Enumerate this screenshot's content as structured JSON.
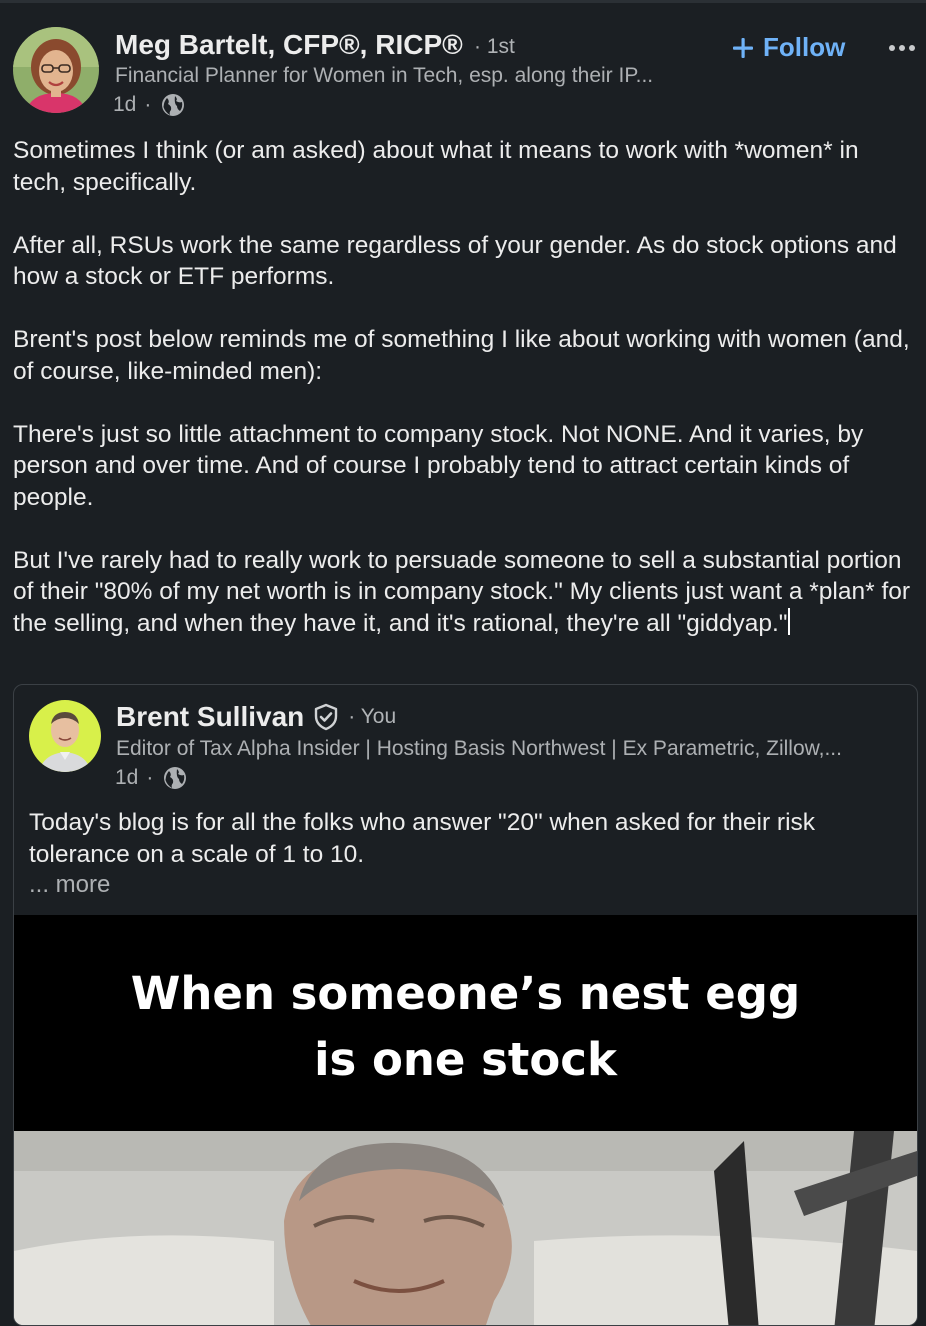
{
  "post": {
    "author": {
      "name": "Meg Bartelt, CFP®, RICP®",
      "degree": "· 1st",
      "headline": "Financial Planner for Women in Tech, esp. along their IP...",
      "time": "1d",
      "visibility_icon": "globe-icon"
    },
    "follow_label": "Follow",
    "more_icon": "ellipsis-icon",
    "paragraphs": [
      "Sometimes I think (or am asked) about what it means to work with *women* in tech, specifically.",
      "After all, RSUs work the same regardless of your gender. As do stock options and how a stock or ETF performs.",
      "Brent's post below reminds me of something I like about working with women (and, of course, like-minded men):",
      "There's just so little attachment to company stock. Not NONE. And it varies, by person and over time. And of course I probably tend to attract certain kinds of people.",
      "But I've rarely had to really work to persuade someone to sell a substantial portion of their \"80% of my net worth is in company stock.\" My clients just want a *plan* for the selling, and when they have it, and it's rational, they're all \"giddyap.\""
    ]
  },
  "shared_post": {
    "author": {
      "name": "Brent Sullivan",
      "verified_icon": "verified-shield-icon",
      "you_label": "· You",
      "headline": "Editor of Tax Alpha Insider | Hosting Basis Northwest | Ex Parametric, Zillow,...",
      "time": "1d",
      "visibility_icon": "globe-icon"
    },
    "text": "Today's blog is for all the folks who answer \"20\" when asked for their risk tolerance on a scale of 1 to 10.",
    "more_label": "... more",
    "meme": {
      "caption_line1": "When someone’s nest egg",
      "caption_line2": "is one stock"
    }
  },
  "colors": {
    "background": "#1b1f23",
    "text": "#ececec",
    "secondary_text": "#adb0b3",
    "link_blue": "#6fb2f7",
    "card_border": "#3b4045"
  }
}
